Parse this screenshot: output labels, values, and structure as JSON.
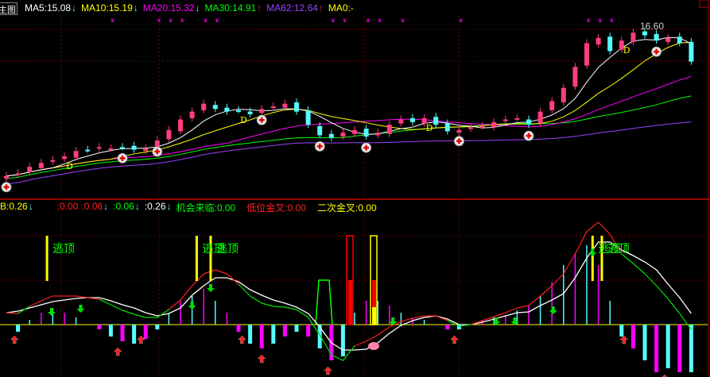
{
  "main_header": {
    "title": "主图",
    "ma5": "MA5:15.08",
    "ma10": "MA10:15.19",
    "ma20": "MA20:15.32",
    "ma30": "MA30:14.91",
    "ma62": "MA62:12.64",
    "ma0": "MA0:-",
    "arrows": {
      "ma5": "↓",
      "ma10": "↓",
      "ma20": "↓",
      "ma30": "↑",
      "ma62": "↑"
    }
  },
  "indicator_header": {
    "b": "B:0.26",
    "v1": ":0.00",
    "v2": ":0.06",
    "v3": ":0.06",
    "v4": ":0.26",
    "chance": "机会来临:0.00",
    "low_cross": "低位金叉:0.00",
    "second_cross": "二次金叉:0.00",
    "arrow": "↓"
  },
  "colors": {
    "up": "#ff3d7f",
    "down": "#54fcfc",
    "ma5": "#ffffff",
    "ma10": "#ffff00",
    "ma20": "#ff00ff",
    "ma30": "#00ff00",
    "ma62": "#a040ff",
    "grid": "#c00000"
  },
  "chart_data": {
    "type": "candlestick",
    "price_ylim": [
      10.3,
      17.0
    ],
    "high_label": "16.60",
    "closes": [
      10.85,
      10.95,
      11.2,
      11.35,
      11.45,
      11.6,
      11.8,
      11.85,
      11.95,
      11.9,
      11.95,
      11.85,
      11.9,
      12.2,
      12.6,
      13.0,
      13.3,
      13.6,
      13.4,
      13.3,
      13.35,
      13.2,
      13.4,
      13.5,
      13.6,
      13.3,
      12.8,
      12.4,
      12.3,
      12.5,
      12.6,
      12.35,
      12.5,
      12.8,
      13.0,
      12.9,
      13.05,
      12.8,
      12.55,
      12.6,
      12.7,
      12.75,
      12.9,
      13.0,
      13.05,
      12.8,
      13.3,
      13.7,
      14.2,
      15.0,
      15.9,
      16.1,
      15.6,
      16.0,
      16.3,
      16.2,
      16.0,
      16.1,
      15.9,
      15.2
    ],
    "buy_signal_bars": [
      0,
      10,
      13,
      22,
      27,
      31,
      39,
      45,
      56
    ],
    "d_label": "D",
    "d_label_bars": [
      5,
      20,
      36,
      53
    ],
    "x_marker_bars": [
      9,
      13,
      14,
      15,
      17,
      18,
      28,
      29,
      31,
      32,
      34,
      39,
      50,
      51,
      52
    ],
    "indicator": {
      "ylim": [
        -0.65,
        1.1
      ],
      "line": [
        0.15,
        0.17,
        0.21,
        0.25,
        0.29,
        0.31,
        0.33,
        0.34,
        0.34,
        0.3,
        0.25,
        0.21,
        0.15,
        0.11,
        0.14,
        0.21,
        0.37,
        0.49,
        0.59,
        0.59,
        0.54,
        0.44,
        0.37,
        0.31,
        0.27,
        0.22,
        0.14,
        -0.03,
        -0.23,
        -0.32,
        -0.32,
        -0.31,
        -0.23,
        -0.11,
        -0.01,
        0.05,
        0.09,
        0.11,
        0.07,
        0,
        0,
        0.03,
        0.07,
        0.11,
        0.15,
        0.16,
        0.24,
        0.31,
        0.39,
        0.59,
        0.84,
        1.04,
        1.04,
        0.94,
        0.87,
        0.79,
        0.69,
        0.51,
        0.34,
        0.14
      ],
      "hist": [
        0,
        -0.09,
        0.06,
        0.15,
        0.21,
        0.15,
        0.09,
        0,
        -0.06,
        -0.15,
        -0.21,
        -0.24,
        -0.18,
        -0.06,
        0.15,
        0.3,
        0.36,
        0.45,
        0.3,
        0.15,
        -0.09,
        -0.24,
        -0.3,
        -0.24,
        -0.15,
        -0.09,
        -0.15,
        -0.3,
        -0.45,
        -0.4,
        0.15,
        0.3,
        0.3,
        0.24,
        0.15,
        0.09,
        0.06,
        0,
        -0.06,
        -0.06,
        0,
        0.06,
        0.09,
        0.12,
        0.18,
        0.24,
        0.36,
        0.54,
        0.75,
        0.9,
        1.0,
        0.75,
        0.3,
        -0.15,
        -0.3,
        -0.45,
        -0.6,
        -0.55,
        -0.6,
        -0.6
      ],
      "escape_top_label": "逃顶",
      "escape_top_bars": [
        3.5,
        16.4,
        17.6,
        50.5,
        51.3
      ],
      "up_arrow_bars": [
        0.7,
        9.6,
        11.6,
        20.3,
        22,
        27.7,
        38.6,
        53.2,
        56.7
      ],
      "down_arrow_bars": [
        3.9,
        6.4,
        16,
        17.6,
        33.3,
        42.2,
        43.8,
        47.1,
        50.5
      ]
    }
  }
}
